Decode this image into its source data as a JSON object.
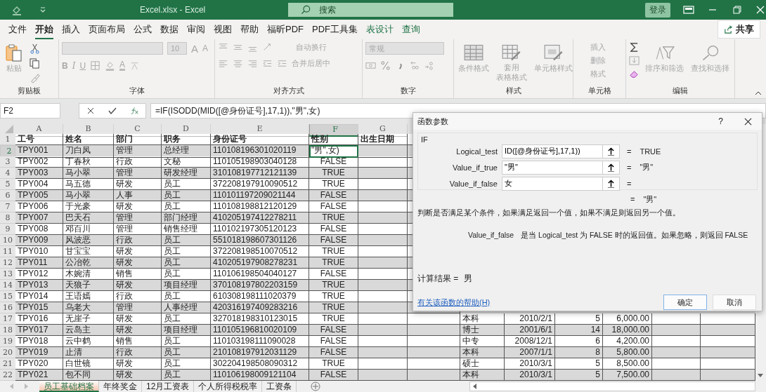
{
  "title_bar": {
    "title": "Excel.xlsx  -  Excel",
    "search_placeholder": "搜索",
    "login": "登录"
  },
  "menu_tabs": [
    {
      "label": "文件",
      "selected": false,
      "kind": "normal"
    },
    {
      "label": "开始",
      "selected": true,
      "kind": "normal"
    },
    {
      "label": "插入",
      "selected": false,
      "kind": "normal"
    },
    {
      "label": "页面布局",
      "selected": false,
      "kind": "normal"
    },
    {
      "label": "公式",
      "selected": false,
      "kind": "normal"
    },
    {
      "label": "数据",
      "selected": false,
      "kind": "normal"
    },
    {
      "label": "审阅",
      "selected": false,
      "kind": "normal"
    },
    {
      "label": "视图",
      "selected": false,
      "kind": "normal"
    },
    {
      "label": "帮助",
      "selected": false,
      "kind": "normal"
    },
    {
      "label": "福昕PDF",
      "selected": false,
      "kind": "normal"
    },
    {
      "label": "PDF工具集",
      "selected": false,
      "kind": "normal"
    },
    {
      "label": "表设计",
      "selected": false,
      "kind": "contextual"
    },
    {
      "label": "查询",
      "selected": false,
      "kind": "contextual"
    }
  ],
  "share_button": "共享",
  "ribbon": {
    "disabled": true,
    "clipboard": {
      "label": "剪贴板",
      "paste": "粘贴"
    },
    "font": {
      "label": "字体",
      "size": "10",
      "grow": "A",
      "shrink": "A",
      "bold": "B",
      "italic": "I",
      "underline": "U",
      "font_color_button": "A"
    },
    "alignment": {
      "label": "对齐方式",
      "wrap": "自动换行",
      "merge": "合并后居中"
    },
    "number": {
      "label": "数字",
      "format": "常规"
    },
    "styles": {
      "label": "样式",
      "conditional": "条件格式",
      "table_lines": [
        "套用",
        "表格格式"
      ],
      "cell_styles": "单元格样式"
    },
    "cells": {
      "label": "单元格",
      "insert": "插入",
      "delete": "删除",
      "format": "格式"
    },
    "editing": {
      "label": "编辑",
      "sort": "排序和筛选",
      "find": "查找和选择"
    }
  },
  "formula_bar": {
    "name_box": "F2",
    "formula": "=IF(ISODD(MID([@身份证号],17,1)),\"男\",女)"
  },
  "sheet": {
    "columns": [
      {
        "letter": "A",
        "selected": false
      },
      {
        "letter": "B",
        "selected": false
      },
      {
        "letter": "C",
        "selected": false
      },
      {
        "letter": "D",
        "selected": false
      },
      {
        "letter": "E",
        "selected": false
      },
      {
        "letter": "F",
        "selected": true
      },
      {
        "letter": "G",
        "selected": false
      }
    ],
    "header": {
      "num": "1",
      "cells": [
        "工号",
        "姓名",
        "部门",
        "职务",
        "身份证号",
        "性别",
        "出生日期"
      ]
    },
    "rows": [
      {
        "num": "2",
        "selected": true,
        "cells": [
          "TPY001",
          "刀白凤",
          "管理",
          "总经理",
          "110108196301020119",
          "\"男\",女)"
        ]
      },
      {
        "num": "3",
        "selected": false,
        "cells": [
          "TPY002",
          "丁春秋",
          "行政",
          "文秘",
          "110105198903040128",
          "FALSE"
        ]
      },
      {
        "num": "4",
        "selected": false,
        "cells": [
          "TPY003",
          "马小翠",
          "管理",
          "研发经理",
          "310108197712121139",
          "TRUE"
        ]
      },
      {
        "num": "5",
        "selected": false,
        "cells": [
          "TPY004",
          "马五德",
          "研发",
          "员工",
          "372208197910090512",
          "TRUE"
        ]
      },
      {
        "num": "6",
        "selected": false,
        "cells": [
          "TPY005",
          "马小翠",
          "人事",
          "员工",
          "110101197209021144",
          "FALSE"
        ]
      },
      {
        "num": "7",
        "selected": false,
        "cells": [
          "TPY006",
          "于光豪",
          "研发",
          "员工",
          "110108198812120129",
          "FALSE"
        ]
      },
      {
        "num": "8",
        "selected": false,
        "cells": [
          "TPY007",
          "巴天石",
          "管理",
          "部门经理",
          "410205197412278211",
          "TRUE"
        ]
      },
      {
        "num": "9",
        "selected": false,
        "cells": [
          "TPY008",
          "邓百川",
          "管理",
          "销售经理",
          "110102197305120123",
          "FALSE"
        ]
      },
      {
        "num": "10",
        "selected": false,
        "cells": [
          "TPY009",
          "风波恶",
          "行政",
          "员工",
          "551018198607301126",
          "FALSE"
        ]
      },
      {
        "num": "11",
        "selected": false,
        "cells": [
          "TPY010",
          "甘宝宝",
          "研发",
          "员工",
          "372208198510070512",
          "TRUE"
        ]
      },
      {
        "num": "12",
        "selected": false,
        "cells": [
          "TPY011",
          "公冶乾",
          "研发",
          "员工",
          "410205197908278231",
          "TRUE"
        ]
      },
      {
        "num": "13",
        "selected": false,
        "cells": [
          "TPY012",
          "木婉清",
          "销售",
          "员工",
          "110106198504040127",
          "FALSE"
        ]
      },
      {
        "num": "14",
        "selected": false,
        "cells": [
          "TPY013",
          "天狼子",
          "研发",
          "项目经理",
          "370108197802203159",
          "TRUE"
        ]
      },
      {
        "num": "15",
        "selected": false,
        "cells": [
          "TPY014",
          "王语嫣",
          "行政",
          "员工",
          "610308198111020379",
          "TRUE"
        ]
      },
      {
        "num": "16",
        "selected": false,
        "cells": [
          "TPY015",
          "乌老大",
          "管理",
          "人事经理",
          "420316197409283216",
          "TRUE"
        ]
      },
      {
        "num": "17",
        "selected": false,
        "cells": [
          "TPY016",
          "无崖子",
          "研发",
          "员工",
          "327018198310123015",
          "TRUE"
        ],
        "extra": [
          "本科",
          "2010/2/1",
          "5",
          "6,000.00"
        ]
      },
      {
        "num": "18",
        "selected": false,
        "cells": [
          "TPY017",
          "云岛主",
          "研发",
          "项目经理",
          "110105196810020109",
          "FALSE"
        ],
        "extra": [
          "博士",
          "2001/6/1",
          "14",
          "18,000.00"
        ]
      },
      {
        "num": "19",
        "selected": false,
        "cells": [
          "TPY018",
          "云中鹤",
          "销售",
          "员工",
          "110103198111090028",
          "FALSE"
        ],
        "extra": [
          "中专",
          "2008/12/1",
          "6",
          "4,200.00"
        ]
      },
      {
        "num": "20",
        "selected": false,
        "cells": [
          "TPY019",
          "止清",
          "行政",
          "员工",
          "210108197912031129",
          "FALSE"
        ],
        "extra": [
          "本科",
          "2007/1/1",
          "8",
          "5,800.00"
        ]
      },
      {
        "num": "21",
        "selected": false,
        "cells": [
          "TPY020",
          "白世镜",
          "研发",
          "员工",
          "302204198508090312",
          "TRUE"
        ],
        "extra": [
          "硕士",
          "2010/3/1",
          "5",
          "8,500.00"
        ]
      },
      {
        "num": "22",
        "selected": false,
        "cells": [
          "TPY021",
          "包不同",
          "研发",
          "员工",
          "110106198009121104",
          "FALSE"
        ],
        "extra": [
          "本科",
          "2010/3/1",
          "5",
          "7,500.00"
        ]
      }
    ]
  },
  "sheet_tabs": [
    {
      "label": "员工基础档案",
      "selected": true
    },
    {
      "label": "年终奖金",
      "selected": false
    },
    {
      "label": "12月工资表",
      "selected": false
    },
    {
      "label": "个人所得税税率",
      "selected": false
    },
    {
      "label": "工资条",
      "selected": false
    }
  ],
  "dialog": {
    "title": "函数参数",
    "help": "?",
    "function": "IF",
    "args": [
      {
        "label": "Logical_test",
        "value": "ID([@身份证号],17,1))",
        "eq": "=",
        "result": "TRUE"
      },
      {
        "label": "Value_if_true",
        "value": "\"男\"",
        "eq": "=",
        "result": "\"男\""
      },
      {
        "label": "Value_if_false",
        "value": "女",
        "eq": "="
      }
    ],
    "overall": {
      "eq": "=",
      "value": "\"男\""
    },
    "description": "判断是否满足某个条件，如果满足返回一个值，如果不满足则返回另一个值。",
    "arg_help": {
      "name": "Value_if_false",
      "text": "是当 Logical_test 为 FALSE 时的返回值。如果忽略，则返回 FALSE"
    },
    "calc_label": "计算结果 =",
    "calc_value": "男",
    "help_link": "有关该函数的帮助(H)",
    "ok": "确定",
    "cancel": "取消"
  }
}
